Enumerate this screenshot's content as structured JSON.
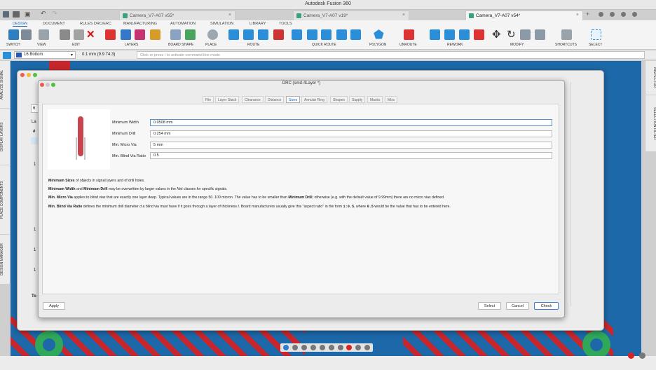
{
  "app": {
    "title": "Autodesk Fusion 360"
  },
  "tabs": [
    {
      "label": "Camera_V7-A07 v55*"
    },
    {
      "label": "Camera_V7-A07 v19*"
    },
    {
      "label": "Camera_V7-A07 v54*"
    }
  ],
  "ribbon": {
    "tabs": [
      "DESIGN",
      "DOCUMENT",
      "RULES DRC/ERC",
      "MANUFACTURING",
      "AUTOMATION",
      "SIMULATION",
      "LIBRARY",
      "TOOLS"
    ],
    "groups": [
      "SWITCH",
      "VIEW",
      "EDIT",
      "LAYERS",
      "BOARD SHAPE",
      "PLACE",
      "ROUTE",
      "QUICK ROUTE",
      "POLYGON",
      "UNROUTE",
      "REWORK",
      "MODIFY",
      "SHORTCUTS",
      "SELECT"
    ]
  },
  "cmdbar": {
    "layer": "16 Bottom",
    "coord": "0.1 mm (9.9 74.3)",
    "placeholder": "Click or press / to activate command line mode"
  },
  "left_panels": [
    "ANALYZE SIGNAL",
    "DISPLAY LAYERS",
    "PLACE COMPONENTS",
    "DESIGN MANAGER"
  ],
  "right_panels": [
    "INSPECTOR",
    "SELECTION FILTER"
  ],
  "behind": {
    "fields": [
      "6",
      "La",
      "#",
      "1",
      "1",
      "1",
      "1",
      "To"
    ]
  },
  "drc": {
    "title": "DRC (smd-4Layer *)",
    "tabs": [
      "File",
      "Layer Stack",
      "Clearance",
      "Distance",
      "Sizes",
      "Annular Ring",
      "Shapes",
      "Supply",
      "Masks",
      "Misc"
    ],
    "active_tab": "Sizes",
    "fields": [
      {
        "label": "Minimum Width",
        "value": "0.0508 mm"
      },
      {
        "label": "Minimum Drill",
        "value": "0.254 mm"
      },
      {
        "label": "Min. Micro Via",
        "value": "5 mm"
      },
      {
        "label": "Min. Blind Via Ratio",
        "value": "0.5"
      }
    ],
    "help": {
      "p1_bold": "Minimum Sizes",
      "p1_rest": " of objects in signal layers and of drill holes.",
      "p2_bold1": "Minimum Width",
      "p2_mid": " and ",
      "p2_bold2": "Minimum Drill",
      "p2_rest1": " may be overwritten by larger values in the ",
      "p2_italic": "Net",
      "p2_rest2": " classes for specific signals.",
      "p3_bold": "Min. Micro Via",
      "p3_a": " applies to ",
      "p3_italic": "blind",
      "p3_b": " vias that are exactly one layer deep. Typical values are in the range 50..100 micron. The value has to be smaller than ",
      "p3_bold2": "Minimum Drill",
      "p3_c": "; otherwise (e.g. with the default value of 9.99mm) there are no micro vias defined.",
      "p4_bold": "Min. Blind Via Ratio",
      "p4_a": " defines the minimum drill diameter ",
      "p4_i1": "d",
      "p4_b": " a blind via must have if it goes through a layer of thickness ",
      "p4_i2": "t",
      "p4_c": ". Board manufacturers usually give this \"aspect ratio\" in the form ",
      "p4_code1": "1:0.5",
      "p4_d": ", where ",
      "p4_code2": "0.5",
      "p4_e": " would be the value that has to be entered here."
    },
    "buttons": {
      "apply": "Apply",
      "select": "Select",
      "cancel": "Cancel",
      "check": "Check"
    }
  }
}
